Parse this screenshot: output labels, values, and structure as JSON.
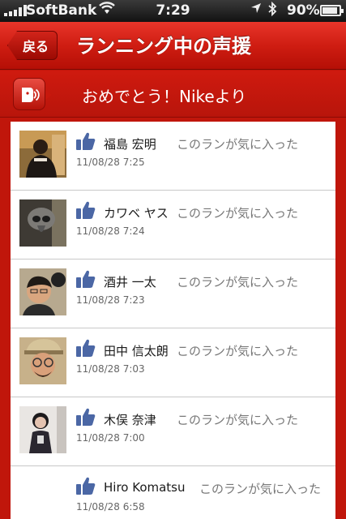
{
  "status_bar": {
    "carrier": "SoftBank",
    "time": "7:29",
    "battery_percent": "90%",
    "battery_level": 0.9
  },
  "nav": {
    "back_label": "戻る",
    "title": "ランニング中の声援"
  },
  "banner": {
    "text": "おめでとう！Nikeより"
  },
  "cheers": [
    {
      "name": "福島 宏明",
      "action": "このランが気に入った",
      "time": "11/08/28 7:25"
    },
    {
      "name": "カワベ ヤス",
      "action": "このランが気に入った",
      "time": "11/08/28 7:24"
    },
    {
      "name": "酒井 一太",
      "action": "このランが気に入った",
      "time": "11/08/28 7:23"
    },
    {
      "name": "田中 信太朗",
      "action": "このランが気に入った",
      "time": "11/08/28 7:03"
    },
    {
      "name": "木俣 奈津",
      "action": "このランが気に入った",
      "time": "11/08/28 7:00"
    },
    {
      "name": "Hiro Komatsu",
      "action": "このランが気に入った",
      "time": "11/08/28 6:58"
    }
  ],
  "colors": {
    "nav_red": "#cf1d12",
    "background_red": "#c0160b",
    "like_blue": "#4b67a5"
  },
  "icons": {
    "like": "thumbs-up-icon",
    "cheer": "speaker-voice-icon"
  }
}
